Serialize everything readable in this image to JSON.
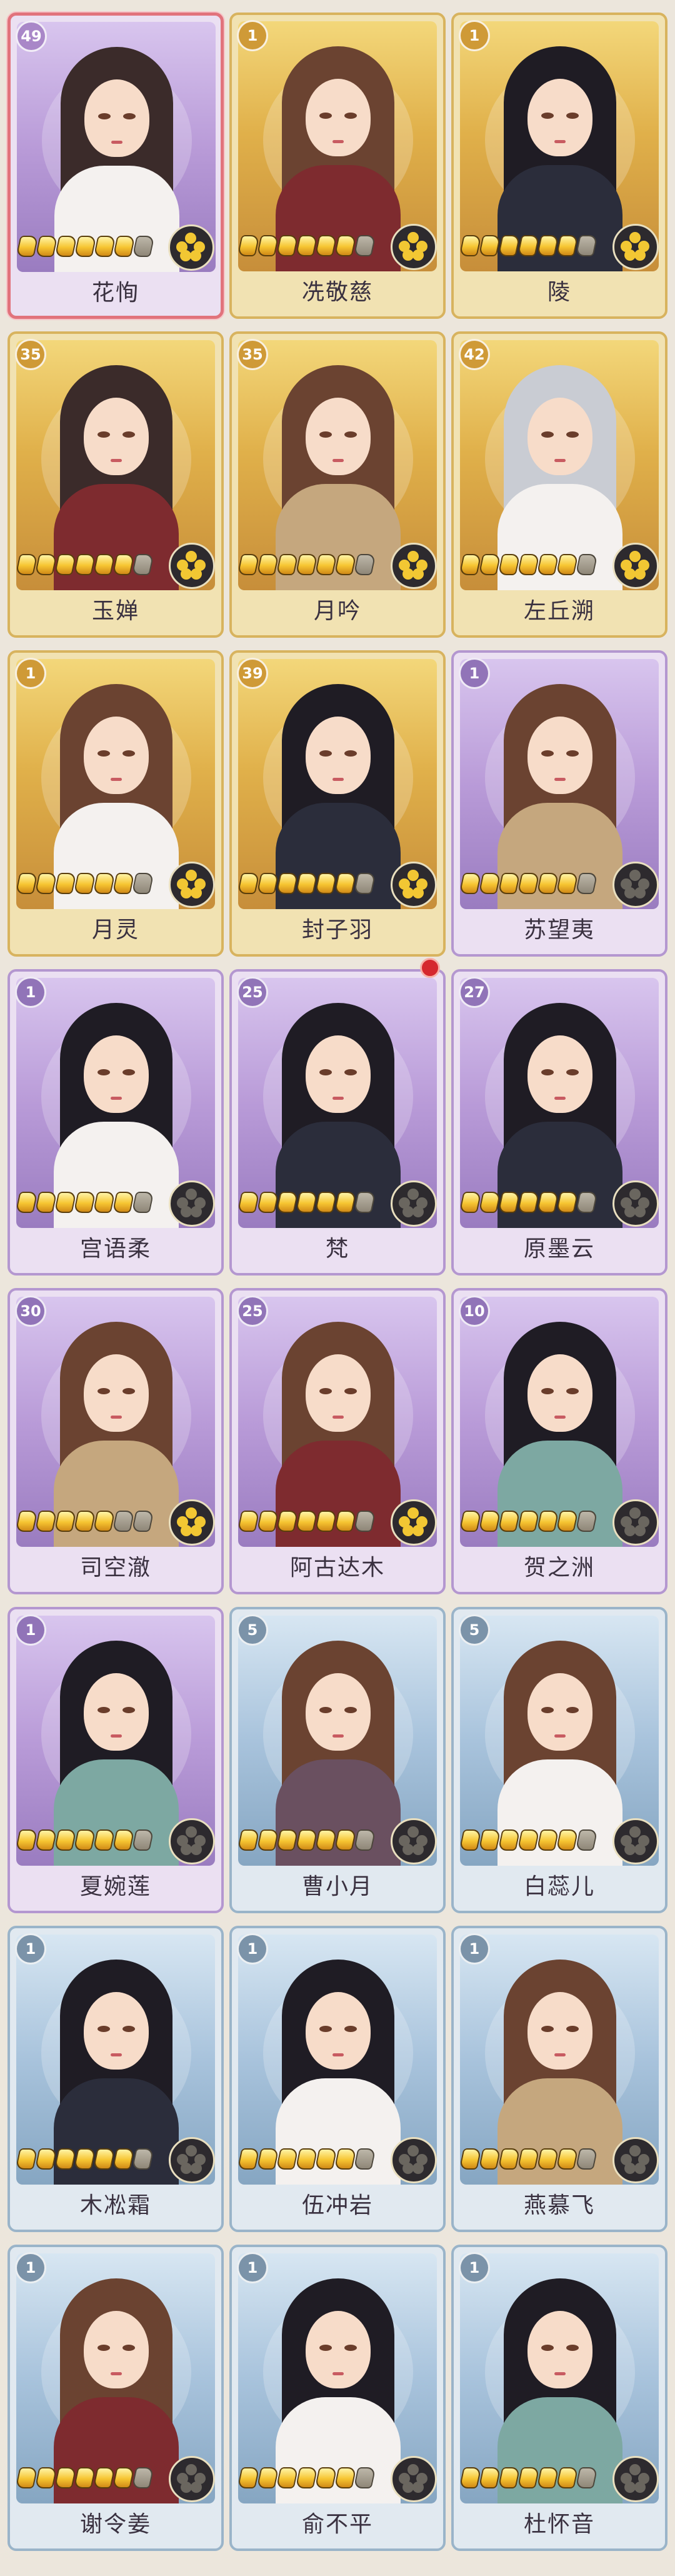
{
  "colors": {
    "page_bg": "#ece6dc",
    "gold_frame": "#d8b35e",
    "purple_frame": "#b497d0",
    "blue_frame": "#9ab4c9",
    "selected_frame": "#e1737c",
    "notification": "#d5282e"
  },
  "characters": [
    {
      "name": "花恂",
      "level": "49",
      "rarity": "purple",
      "selected": true
    },
    {
      "name": "冼敬慈",
      "level": "1",
      "rarity": "gold"
    },
    {
      "name": "陵",
      "level": "1",
      "rarity": "gold"
    },
    {
      "name": "玉婵",
      "level": "35",
      "rarity": "gold"
    },
    {
      "name": "月吟",
      "level": "35",
      "rarity": "gold"
    },
    {
      "name": "左丘溯",
      "level": "42",
      "rarity": "gold"
    },
    {
      "name": "月灵",
      "level": "1",
      "rarity": "gold"
    },
    {
      "name": "封子羽",
      "level": "39",
      "rarity": "gold"
    },
    {
      "name": "苏望夷",
      "level": "1",
      "rarity": "purple"
    },
    {
      "name": "宫语柔",
      "level": "1",
      "rarity": "purple"
    },
    {
      "name": "梵",
      "level": "25",
      "rarity": "purple",
      "has_notification": true
    },
    {
      "name": "原墨云",
      "level": "27",
      "rarity": "purple"
    },
    {
      "name": "司空澈",
      "level": "30",
      "rarity": "purple"
    },
    {
      "name": "阿古达木",
      "level": "25",
      "rarity": "purple"
    },
    {
      "name": "贺之洲",
      "level": "10",
      "rarity": "purple"
    },
    {
      "name": "夏婉莲",
      "level": "1",
      "rarity": "purple"
    },
    {
      "name": "曹小月",
      "level": "5",
      "rarity": "blue"
    },
    {
      "name": "白蕊儿",
      "level": "5",
      "rarity": "blue"
    },
    {
      "name": "木凇霜",
      "level": "1",
      "rarity": "blue"
    },
    {
      "name": "伍冲岩",
      "level": "1",
      "rarity": "blue"
    },
    {
      "name": "燕慕飞",
      "level": "1",
      "rarity": "blue"
    },
    {
      "name": "谢令姜",
      "level": "1",
      "rarity": "blue"
    },
    {
      "name": "俞不平",
      "level": "1",
      "rarity": "blue"
    },
    {
      "name": "杜怀音",
      "level": "1",
      "rarity": "blue"
    }
  ]
}
